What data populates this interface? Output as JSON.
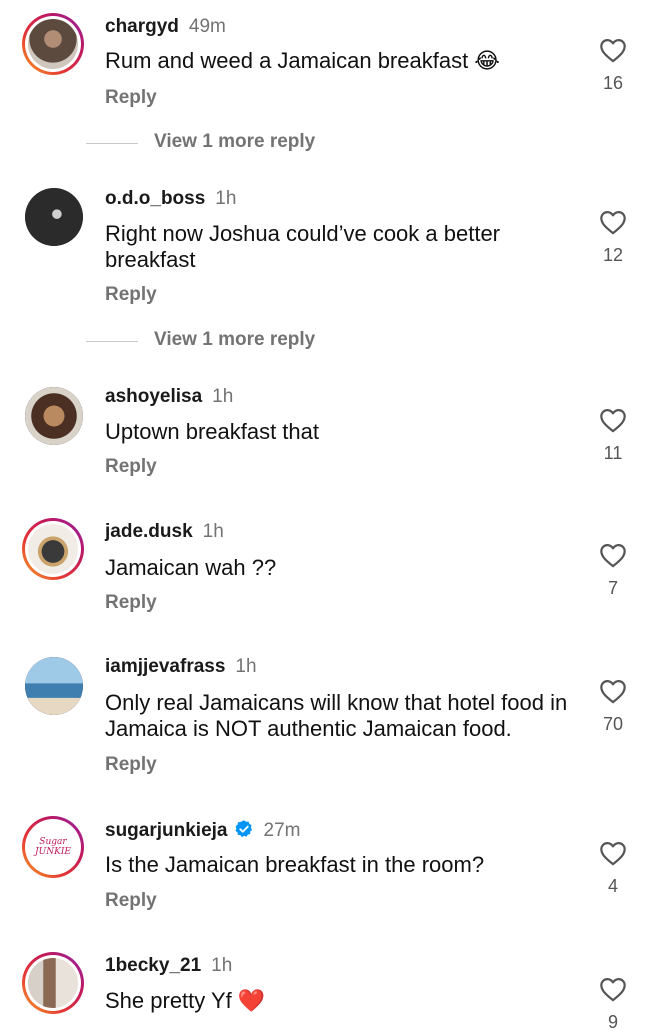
{
  "comments": [
    {
      "user": "chargyd",
      "time": "49m",
      "text": "Rum and weed a Jamaican breakfast 😂",
      "likes": "16",
      "reply": "Reply",
      "more_replies": "View 1 more reply"
    },
    {
      "user": "o.d.o_boss",
      "time": "1h",
      "text": "Right now Joshua could’ve cook a better breakfast",
      "likes": "12",
      "reply": "Reply",
      "more_replies": "View 1 more reply"
    },
    {
      "user": "ashoyelisa",
      "time": "1h",
      "text": "Uptown breakfast that",
      "likes": "11",
      "reply": "Reply"
    },
    {
      "user": "jade.dusk",
      "time": "1h",
      "text": "Jamaican wah ??",
      "likes": "7",
      "reply": "Reply"
    },
    {
      "user": "iamjjevafrass",
      "time": "1h",
      "text": "Only real Jamaicans will know that hotel food in Jamaica is NOT authentic Jamaican food.",
      "likes": "70",
      "reply": "Reply"
    },
    {
      "user": "sugarjunkieja",
      "verified": true,
      "time": "27m",
      "text": "Is the Jamaican breakfast in the room?",
      "likes": "4",
      "reply": "Reply",
      "avatar_text": "Sugar JUNKIE"
    },
    {
      "user": "1becky_21",
      "time": "1h",
      "text": "She pretty Yf ❤️",
      "likes": "9"
    }
  ],
  "icons": {
    "like": "heart-outline-icon",
    "verified": "verified-badge-icon"
  },
  "colors": {
    "accent_verified": "#0095f6",
    "muted": "#737373",
    "story_ring": "#c2185b"
  }
}
